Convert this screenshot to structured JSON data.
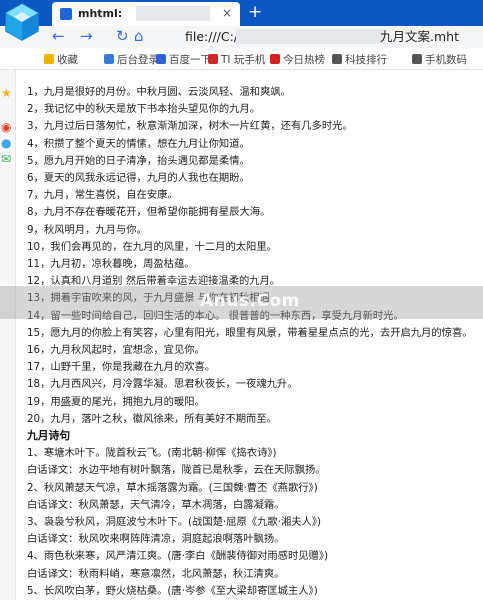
{
  "tab": {
    "title": "mhtml:",
    "close": "×",
    "new_tab": "+"
  },
  "nav": {
    "back": "←",
    "forward": "→",
    "reload": "↻",
    "home": "⌂",
    "address_prefix": "file:///C:/U",
    "address_suffix": "九月文案.mht"
  },
  "bookmarks": [
    {
      "label": "收藏",
      "icon": "star-icon",
      "color": "#f0b400"
    },
    {
      "label": "后台登录",
      "icon": "page-icon",
      "color": "#3b7bd8"
    },
    {
      "label": "百度一下",
      "icon": "baidu-icon",
      "color": "#2f62d8"
    },
    {
      "label": "TI 玩手机",
      "icon": "ti-icon",
      "color": "#cc2a2a"
    },
    {
      "label": "今日热榜",
      "icon": "hot-icon",
      "color": "#d42020"
    },
    {
      "label": "科技排行",
      "icon": "rank-icon",
      "color": "#555555"
    },
    {
      "label": "手机数码",
      "icon": "phone-icon",
      "color": "#555555"
    }
  ],
  "sidebar": [
    {
      "icon": "star-icon",
      "glyph": "★",
      "color": "#f2b01e"
    },
    {
      "icon": "weibo-icon",
      "glyph": "◉",
      "color": "#e63d2f"
    },
    {
      "icon": "chat-icon",
      "glyph": "●",
      "color": "#3da6f0"
    },
    {
      "icon": "mail-icon",
      "glyph": "✉",
      "color": "#33b04a"
    }
  ],
  "lines": [
    {
      "text": "1，九月是很好的月份。中秋月圆、云淡风轻、温和爽飒。",
      "bold": false
    },
    {
      "text": "2，我记忆中的秋天是放下书本抬头望见你的九月。",
      "bold": false
    },
    {
      "text": "3，九月过后日落匆忙，秋意渐渐加深，树木一片红黄，还有几多时光。",
      "bold": false
    },
    {
      "text": "4，积攒了整个夏天的情愫，想在九月让你知道。",
      "bold": false
    },
    {
      "text": "5，愿九月开始的日子清净，抬头遇见都是柔情。",
      "bold": false
    },
    {
      "text": "6，夏天的风我永远记得，九月的人我也在期盼。",
      "bold": false
    },
    {
      "text": "7，九月，常生喜悦，自在安康。",
      "bold": false
    },
    {
      "text": "8，九月不存在春暖花开，但希望你能拥有星辰大海。",
      "bold": false
    },
    {
      "text": "9，秋风明月，九月与你。",
      "bold": false
    },
    {
      "text": "10，我们会再见的，在九月的风里，十二月的太阳里。",
      "bold": false
    },
    {
      "text": "11，九月初，凉秋暮晚，周盈枯蕴。",
      "bold": false
    },
    {
      "text": "12，认真和八月道别  然后带着幸运去迎接温柔的九月。",
      "bold": false
    },
    {
      "text": "13，拥着宇宙吹来的风，于九月盛景  与你在初秋相遇。",
      "bold": false
    },
    {
      "text": "14，留一些时间给自己，回归生活的本心。  很普普的一种东西，享受九月新时光。",
      "bold": false
    },
    {
      "text": "15，愿九月的你脸上有笑容，心里有阳光，眼里有风景，带着星星点点的光，去开启九月的惊喜。",
      "bold": false
    },
    {
      "text": "16，九月秋风起时，宜想念，宜见你。",
      "bold": false
    },
    {
      "text": "17，山野千里，你是我藏在九月的欢喜。",
      "bold": false
    },
    {
      "text": "18，九月西风兴，月冷露华凝。思君秋夜长，一夜魂九升。",
      "bold": false
    },
    {
      "text": "19，用盛夏的尾光，拥抱九月的暖阳。",
      "bold": false
    },
    {
      "text": "20，九月，落叶之秋，徽风徐来，所有美好不期而至。",
      "bold": false
    },
    {
      "text": "九月诗句",
      "bold": true
    },
    {
      "text": "1、寒塘木叶下。陇首秋云飞。(南北朝·柳恽《捣衣诗》)",
      "bold": false
    },
    {
      "text": "白话译文：水边平地有树叶飘落，陇首已是秋季，云在天际飘扬。",
      "bold": false
    },
    {
      "text": "2、秋风萧瑟天气凉，草木摇落露为霜。(三国魏·曹丕《燕歌行》)",
      "bold": false
    },
    {
      "text": "白话译文：秋风萧瑟，天气清冷，草木凋落，白露凝霜。",
      "bold": false
    },
    {
      "text": "3、袅袅兮秋风，洞庭波兮木叶下。(战国楚·屈原《九歌·湘夫人》)",
      "bold": false
    },
    {
      "text": "白话译文：秋风吹来啊阵阵清凉，洞庭起浪啊落叶飘扬。",
      "bold": false
    },
    {
      "text": "4、雨色秋来寒，风严清江爽。(唐·李白《酬裴侍御对雨感时见赠》)",
      "bold": false
    },
    {
      "text": "白话译文：秋雨料峭，寒意凛然，北风萧瑟，秋江清爽。",
      "bold": false
    },
    {
      "text": "5、长风吹白茅，野火烧枯桑。(唐·岑参《至大梁却寄匡城主人》)",
      "bold": false
    }
  ],
  "watermark": "Anus.Com"
}
